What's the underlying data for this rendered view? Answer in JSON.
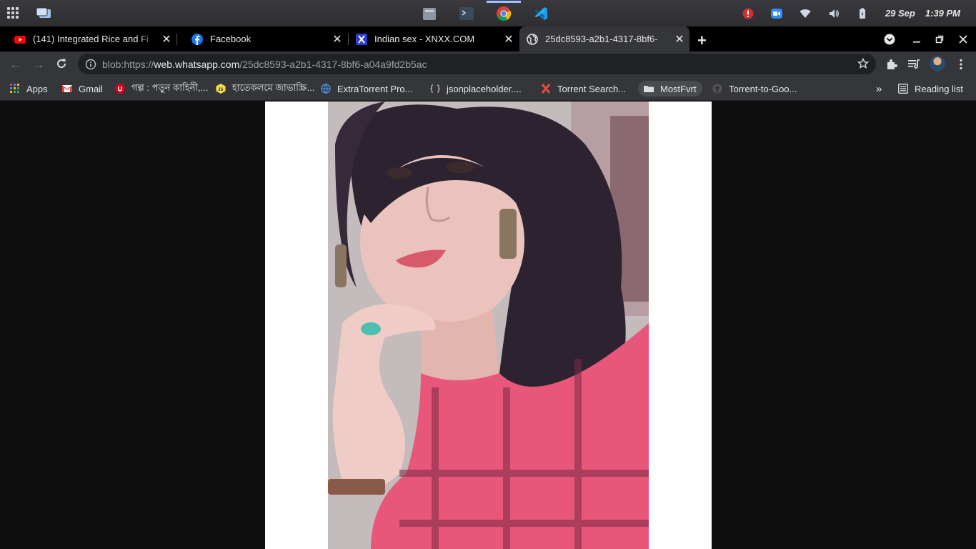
{
  "os": {
    "date": "29 Sep",
    "time": "1:39 PM",
    "apps": [
      "files-icon",
      "terminal-icon",
      "chrome-icon",
      "vscode-icon"
    ],
    "tray": [
      "alert-icon",
      "zoom-icon",
      "wifi-icon",
      "volume-icon",
      "battery-icon"
    ]
  },
  "tabs": [
    {
      "title": "(141) Integrated Rice and Fi",
      "icon": "youtube-icon",
      "active": false
    },
    {
      "title": "Facebook",
      "icon": "facebook-icon",
      "active": false
    },
    {
      "title": "Indian sex - XNXX.COM",
      "icon": "x-icon",
      "active": false
    },
    {
      "title": "25dc8593-a2b1-4317-8bf6-",
      "icon": "globe-icon",
      "active": true
    }
  ],
  "toolbar": {
    "url_prefix": "blob:https://",
    "url_host": "web.whatsapp.com",
    "url_path": "/25dc8593-a2b1-4317-8bf6-a04a9fd2b5ac"
  },
  "bookmarks": {
    "items": [
      {
        "label": "Apps",
        "icon": "apps-grid-icon"
      },
      {
        "label": "Gmail",
        "icon": "gmail-icon"
      },
      {
        "label": "গল্প : পড়ুন কাহিনী,...",
        "icon": "story-icon"
      },
      {
        "label": "হাতেকলমে জাভাস্ক্রি...",
        "icon": "js-icon"
      },
      {
        "label": "ExtraTorrent Pro...",
        "icon": "globe-icon"
      },
      {
        "label": "jsonplaceholder....",
        "icon": "json-icon"
      },
      {
        "label": "Torrent Search...",
        "icon": "torrent-icon"
      },
      {
        "label": "MostFvrt",
        "icon": "folder-icon"
      },
      {
        "label": "Torrent-to-Goo...",
        "icon": "github-icon"
      }
    ],
    "overflow": "»",
    "reading_list": "Reading list"
  },
  "colors": {
    "chrome_dark": "#35363a",
    "tab_strip": "#000000",
    "omnibox": "#202124",
    "page_bg": "#0e0e0e"
  }
}
